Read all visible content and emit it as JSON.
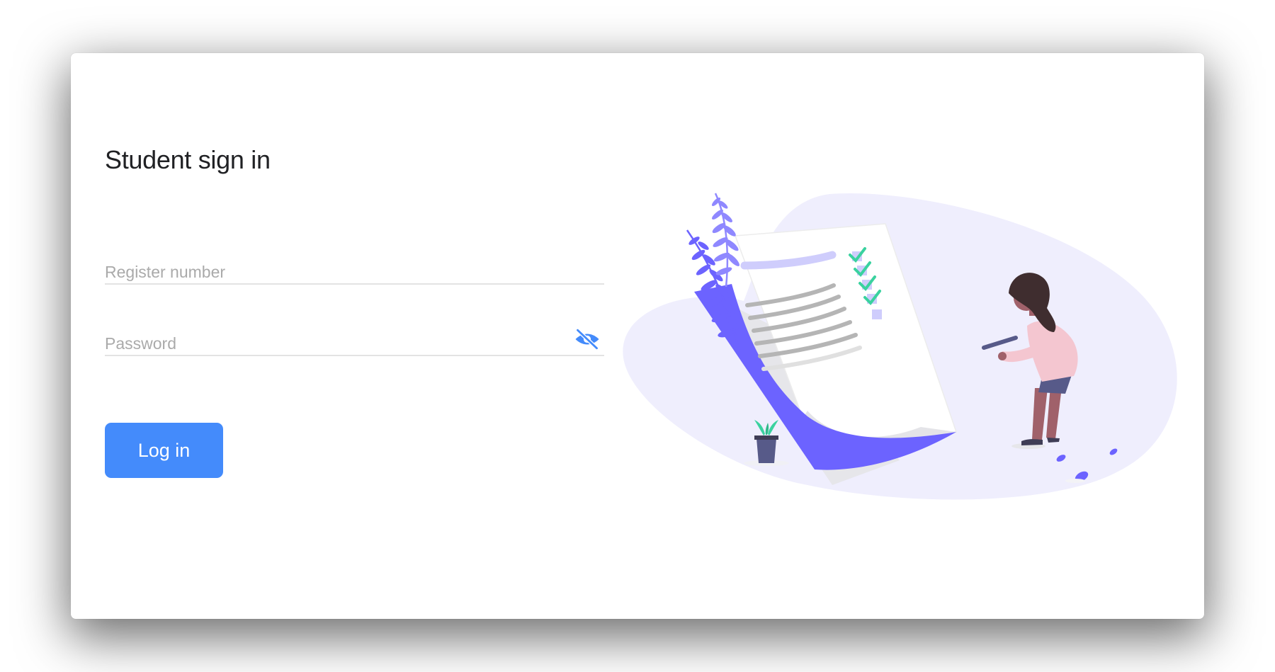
{
  "page": {
    "title": "Student sign in"
  },
  "form": {
    "register_placeholder": "Register number",
    "register_value": "",
    "password_placeholder": "Password",
    "password_value": "",
    "login_label": "Log in"
  },
  "icons": {
    "password_toggle": "eye-off-icon"
  },
  "colors": {
    "accent": "#448bfb",
    "illustration_primary": "#6c63ff",
    "illustration_blob": "#efeefd",
    "check": "#3ad29f"
  }
}
